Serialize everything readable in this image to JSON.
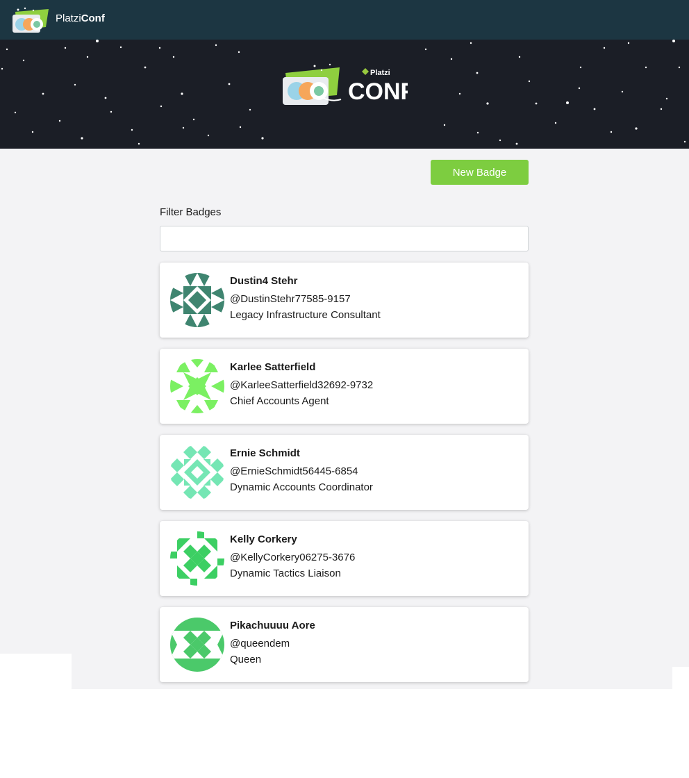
{
  "navbar": {
    "brand_light": "Platzi",
    "brand_bold": "Conf"
  },
  "hero": {
    "logo_small": "Platzi",
    "logo_big": "CONF"
  },
  "actions": {
    "new_badge_label": "New Badge"
  },
  "filter": {
    "label": "Filter Badges",
    "value": "",
    "placeholder": ""
  },
  "badges": [
    {
      "name": "Dustin4 Stehr",
      "handle": "@DustinStehr77585-9157",
      "job": "Legacy Infrastructure Consultant",
      "color": "#3f8570"
    },
    {
      "name": "Karlee Satterfield",
      "handle": "@KarleeSatterfield32692-9732",
      "job": "Chief Accounts Agent",
      "color": "#7bf062"
    },
    {
      "name": "Ernie Schmidt",
      "handle": "@ErnieSchmidt56445-6854",
      "job": "Dynamic Accounts Coordinator",
      "color": "#75e6b4"
    },
    {
      "name": "Kelly Corkery",
      "handle": "@KellyCorkery06275-3676",
      "job": "Dynamic Tactics Liaison",
      "color": "#3ccf63"
    },
    {
      "name": "Pikachuuuu Aore",
      "handle": "@queendem",
      "job": "Queen",
      "color": "#4bc96a"
    }
  ]
}
